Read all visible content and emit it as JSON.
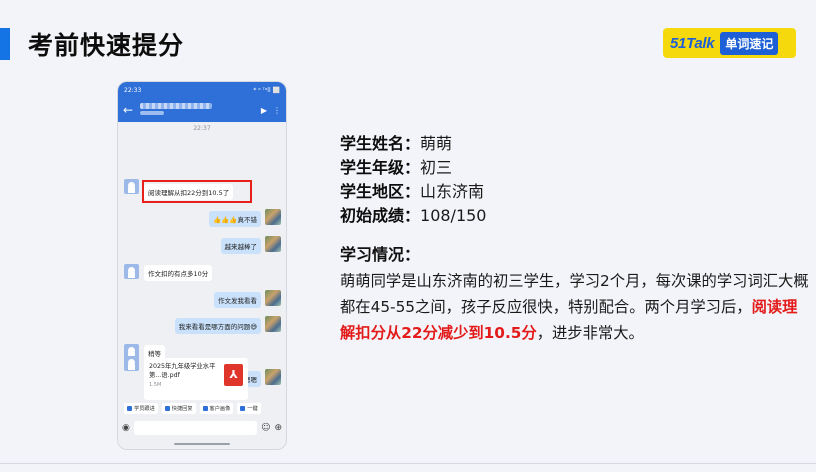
{
  "slide": {
    "title": "考前快速提分",
    "logo_brand": "51Talk",
    "logo_tag": "单词速记"
  },
  "phone": {
    "status_time": "22:33",
    "status_right": "* ᵒ ᵀᵃll ⬜",
    "chat_time": "22:37",
    "messages": {
      "m1": "阅读理解从扣22分到10.5了",
      "m2": "👍👍👍真不错",
      "m3": "越来越棒了",
      "m4": "作文扣的有点多10分",
      "m5": "作文发我看看",
      "m6": "我来看看是哪方面的问题😅",
      "m7": "稍等",
      "m8": "嗯嗯"
    },
    "pdf": {
      "name": "2025年九年级学业水平第...语.pdf",
      "size": "1.5M"
    },
    "quick_bar": [
      "学员跟进",
      "快捷回复",
      "客户画像",
      "一键"
    ]
  },
  "student": {
    "name_label": "学生姓名：",
    "name": "萌萌",
    "grade_label": "学生年级：",
    "grade": "初三",
    "region_label": "学生地区：",
    "region": "山东济南",
    "score_label": "初始成绩：",
    "score": "108/150"
  },
  "study": {
    "title": "学习情况：",
    "text_part1": "萌萌同学是山东济南的初三学生，学习2个月，每次课的学习词汇大概都在45-55之间，孩子反应很快，特别配合。两个月学习后，",
    "text_highlight": "阅读理解扣分从22分减少到10.5分",
    "text_part2": "，进步非常大。"
  },
  "colors": {
    "accent_blue": "#1474e6",
    "logo_yellow": "#f5d90c",
    "highlight_red": "#e31b1b"
  }
}
